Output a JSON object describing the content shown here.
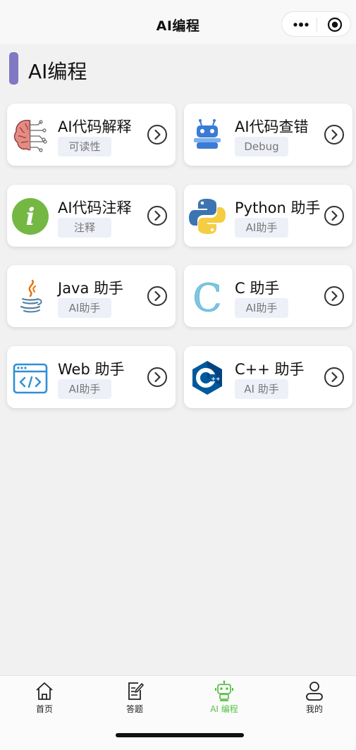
{
  "header": {
    "title": "AI编程",
    "capsule": {
      "more_icon": "more-dots-icon",
      "close_icon": "target-icon"
    }
  },
  "section": {
    "title": "AI编程"
  },
  "cards": [
    {
      "title": "AI代码解释",
      "tag": "可读性",
      "icon": "brain-circuit-icon"
    },
    {
      "title": "AI代码查错",
      "tag": "Debug",
      "icon": "robot-icon"
    },
    {
      "title": "AI代码注释",
      "tag": "注释",
      "icon": "info-icon"
    },
    {
      "title": "Python 助手",
      "tag": "AI助手",
      "icon": "python-icon"
    },
    {
      "title": "Java 助手",
      "tag": "AI助手",
      "icon": "java-icon"
    },
    {
      "title": "C 助手",
      "tag": "AI助手",
      "icon": "c-icon"
    },
    {
      "title": "Web 助手",
      "tag": "AI助手",
      "icon": "web-code-icon"
    },
    {
      "title": "C++ 助手",
      "tag": "AI 助手",
      "icon": "cpp-icon"
    }
  ],
  "tabbar": {
    "items": [
      {
        "label": "首页",
        "icon": "home-icon"
      },
      {
        "label": "答题",
        "icon": "edit-icon"
      },
      {
        "label": "AI 编程",
        "icon": "robot-icon",
        "active": true
      },
      {
        "label": "我的",
        "icon": "user-icon"
      }
    ],
    "active_color": "#59c144"
  },
  "colors": {
    "accent_bar": "#7f78c3",
    "tag_bg": "#eef0f8",
    "page_bg": "#f1f1f1"
  }
}
